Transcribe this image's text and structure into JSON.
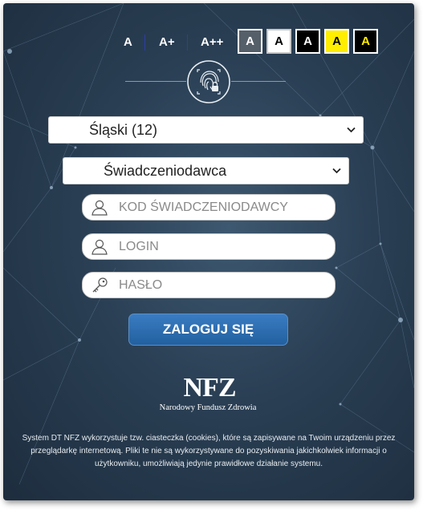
{
  "accessibility": {
    "font_sizes": [
      "A",
      "A+",
      "A++"
    ],
    "contrast": [
      {
        "label": "A",
        "bg": "#555f6a",
        "fg": "#ffffff"
      },
      {
        "label": "A",
        "bg": "#ffffff",
        "fg": "#000000"
      },
      {
        "label": "A",
        "bg": "#000000",
        "fg": "#ffffff"
      },
      {
        "label": "A",
        "bg": "#ffee00",
        "fg": "#000000"
      },
      {
        "label": "A",
        "bg": "#000000",
        "fg": "#ffee00"
      }
    ]
  },
  "form": {
    "region_select": {
      "value": "Śląski (12)"
    },
    "role_select": {
      "value": "Świadczeniodawca"
    },
    "provider_code": {
      "placeholder": "KOD ŚWIADCZENIODAWCY",
      "icon": "user-icon"
    },
    "login": {
      "placeholder": "LOGIN",
      "icon": "user-icon"
    },
    "password": {
      "placeholder": "HASŁO",
      "icon": "key-icon"
    },
    "submit_label": "ZALOGUJ SIĘ"
  },
  "branding": {
    "logo_text": "NFZ",
    "logo_subtitle": "Narodowy Fundusz Zdrowia",
    "fingerprint_icon": "fingerprint-icon"
  },
  "cookie_notice": "System DT NFZ wykorzystuje tzw. ciasteczka (cookies), które są zapisywane na Twoim urządzeniu przez przeglądarkę internetową. Pliki te nie są wykorzystywane do pozyskiwania jakichkolwiek informacji o użytkowniku, umożliwiają jedynie prawidłowe działanie systemu.",
  "colors": {
    "background": "#2a3f54",
    "button": "#2a6aad",
    "accent_yellow": "#ffee00"
  }
}
